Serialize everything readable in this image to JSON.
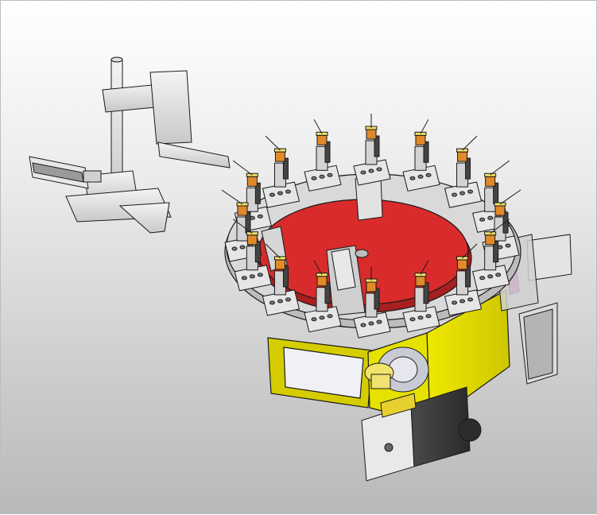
{
  "viewport": {
    "kind": "3D CAD model render",
    "background": "gradient-gray"
  },
  "colors": {
    "turntable_top": "#d92b2b",
    "frame": "#e6e000",
    "steel": "#d9d9d9",
    "outline": "#1a1a1a",
    "coil": "#e08a2a",
    "gear": "#f2e36b",
    "accent": "#c02fb4"
  },
  "model": {
    "station_count": 16,
    "parts": [
      "rotary-index-table",
      "red-turntable-plate",
      "yellow-base-frame",
      "stepper-motor",
      "pick-and-place-gantry",
      "pneumatic-cylinder",
      "linear-actuator-right"
    ]
  }
}
